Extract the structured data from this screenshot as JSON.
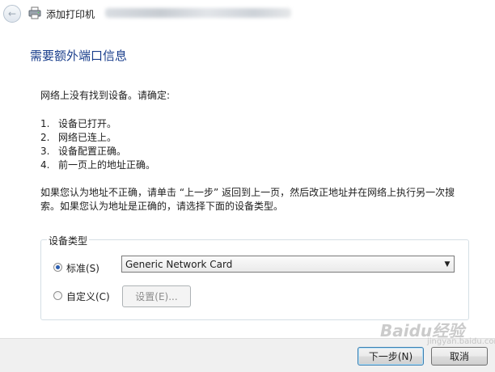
{
  "window": {
    "title": "添加打印机"
  },
  "heading": "需要额外端口信息",
  "intro": "网络上没有找到设备。请确定:",
  "checklist": [
    {
      "num": "1.",
      "text": "设备已打开。"
    },
    {
      "num": "2.",
      "text": "网络已连上。"
    },
    {
      "num": "3.",
      "text": "设备配置正确。"
    },
    {
      "num": "4.",
      "text": "前一页上的地址正确。"
    }
  ],
  "explanation": {
    "line1": "如果您认为地址不正确，请单击 “上一步” 返回到上一页，然后改正地址并在网络上执行另一次搜",
    "line2": "索。如果您认为地址是正确的，请选择下面的设备类型。"
  },
  "device_type": {
    "group_label": "设备类型",
    "standard_label": "标准(S)",
    "standard_selected": true,
    "standard_value": "Generic Network Card",
    "custom_label": "自定义(C)",
    "custom_selected": false,
    "settings_label": "设置(E)..."
  },
  "footer": {
    "next_label": "下一步(N)",
    "cancel_label": "取消"
  },
  "watermark": {
    "text": "Baidu经验",
    "sub": "jingyan.baidu.com"
  }
}
